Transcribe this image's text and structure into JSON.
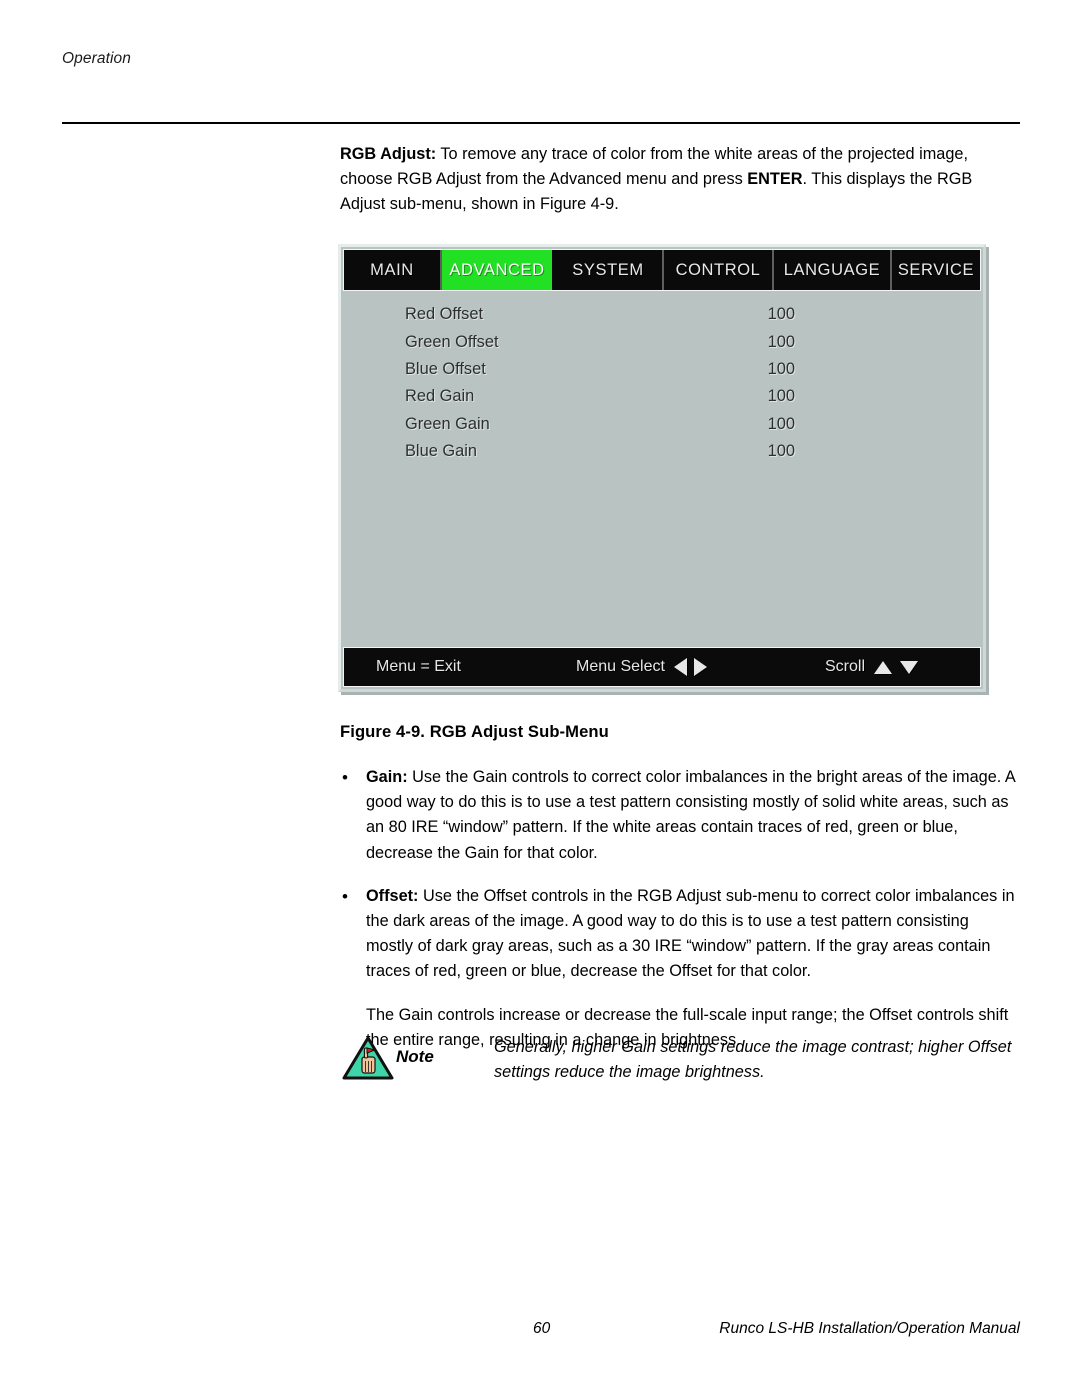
{
  "header": {
    "section": "Operation"
  },
  "intro": {
    "lead": "RGB Adjust:",
    "rest": " To remove any trace of color from the white areas of the projected image, choose RGB Adjust from the Advanced menu and press ",
    "emph": "ENTER",
    "tail": ". This displays the RGB Adjust sub-menu, shown in Figure 4-9."
  },
  "osd": {
    "tabs": [
      {
        "label": "MAIN",
        "selected": false
      },
      {
        "label": "ADVANCED",
        "selected": true
      },
      {
        "label": "SYSTEM",
        "selected": false
      },
      {
        "label": "CONTROL",
        "selected": false
      },
      {
        "label": "LANGUAGE",
        "selected": false
      },
      {
        "label": "SERVICE",
        "selected": false
      }
    ],
    "rows": [
      {
        "label": "Red Offset",
        "value": "100"
      },
      {
        "label": "Green Offset",
        "value": "100"
      },
      {
        "label": "Blue Offset",
        "value": "100"
      },
      {
        "label": "Red Gain",
        "value": "100"
      },
      {
        "label": "Green Gain",
        "value": "100"
      },
      {
        "label": "Blue Gain",
        "value": "100"
      }
    ],
    "status": {
      "exit": "Menu = Exit",
      "select": "Menu Select",
      "scroll": "Scroll"
    },
    "colors": {
      "panel_bg": "#b9c4c2",
      "tab_bg": "#0a0a0a",
      "tab_selected_bg": "#22e024",
      "tab_text": "#e8e8e8",
      "row_text": "#2c2f2e"
    }
  },
  "caption": "Figure 4-9. RGB Adjust Sub-Menu",
  "bullets": [
    {
      "lead": "Gain:",
      "text": " Use the Gain controls to correct color imbalances in the bright areas of the image. A good way to do this is to use a test pattern consisting mostly of solid white areas, such as an 80 IRE “window” pattern. If the white areas contain traces of red, green or blue, decrease the Gain for that color.",
      "bullet_glyph": "•"
    },
    {
      "lead": "Offset:",
      "text": " Use the Offset controls in the RGB Adjust sub-menu to correct color imbalances in the dark areas of the image. A good way to do this is to use a test pattern consisting mostly of dark gray areas, such as a 30 IRE “window” pattern. If the gray areas contain traces of red, green or blue, decrease the Offset for that color.",
      "bullet_glyph": "•"
    }
  ],
  "closing_paragraph": "The Gain controls increase or decrease the full-scale input range; the Offset controls shift the entire range, resulting in a change in brightness.",
  "note": {
    "label": "Note",
    "text": "Generally, higher Gain settings reduce the image contrast; higher Offset settings reduce the image brightness.",
    "icon_colors": {
      "triangle_fill": "#3ed6a8",
      "triangle_border": "#111111",
      "hand": "#f0c49a",
      "flag": "#e02020"
    }
  },
  "footer": {
    "page_number": "60",
    "manual_title": "Runco LS-HB Installation/Operation Manual"
  }
}
